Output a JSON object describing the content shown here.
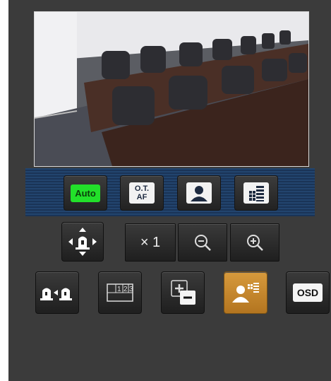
{
  "video": {
    "description_icon": "camera-live-view"
  },
  "scene_strip": {
    "auto_label": "Auto",
    "otaf_line1": "O.T.",
    "otaf_line2": "AF"
  },
  "zoom": {
    "level_label": "× 1"
  },
  "osd_label": "OSD",
  "colors": {
    "accent_green": "#22e02a",
    "active_orange": "#c88a2a",
    "strip_blue": "#22446e"
  }
}
